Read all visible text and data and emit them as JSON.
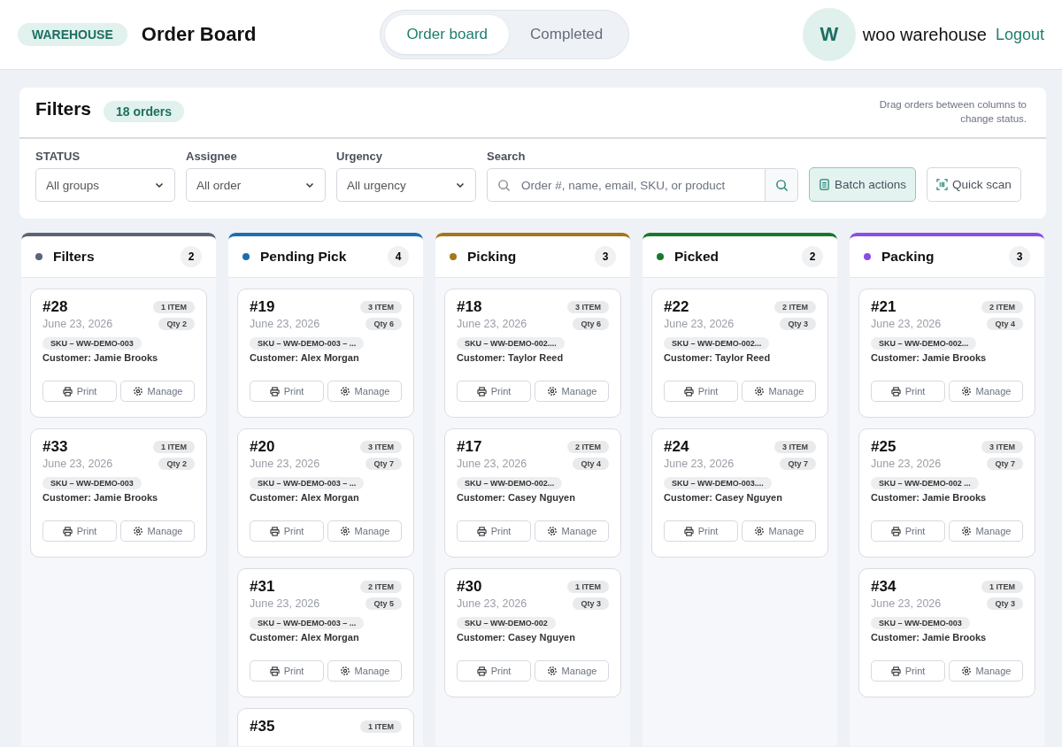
{
  "header": {
    "badge": "WAREHOUSE",
    "title": "Order Board",
    "tabs": [
      {
        "label": "Order board",
        "selected": true
      },
      {
        "label": "Completed",
        "selected": false
      }
    ],
    "avatar": "W",
    "user": "woo warehouse",
    "logout": "Logout"
  },
  "filters": {
    "title": "Filters",
    "count": "18 orders",
    "hint": "Drag orders between columns to change status.",
    "selects": [
      {
        "label": "STATUS",
        "value": "All groups"
      },
      {
        "label": "Assignee",
        "value": "All order"
      },
      {
        "label": "Urgency",
        "value": "All urgency"
      }
    ],
    "search": {
      "label": "Search",
      "placeholder": "Order #, name, email, SKU, or product"
    },
    "actions": [
      {
        "label": "Batch actions",
        "kind": "batch",
        "active": true
      },
      {
        "label": "Quick scan",
        "kind": "scan",
        "active": false
      }
    ]
  },
  "columns": [
    {
      "name": "Filters",
      "color": "#5b6478",
      "count": "2",
      "orders": [
        {
          "number": "#28",
          "items": "1 ITEM",
          "date": "June 23, 2026",
          "qty": "Qty 2",
          "sku": "SKU – WW-DEMO-003",
          "customer": "Customer: Jamie Brooks",
          "print": "Print",
          "manage": "Manage"
        },
        {
          "number": "#33",
          "items": "1 ITEM",
          "date": "June 23, 2026",
          "qty": "Qty 2",
          "sku": "SKU – WW-DEMO-003",
          "customer": "Customer: Jamie Brooks",
          "print": "Print",
          "manage": "Manage"
        }
      ]
    },
    {
      "name": "Pending Pick",
      "color": "#1a6fb3",
      "count": "4",
      "orders": [
        {
          "number": "#19",
          "items": "3 ITEM",
          "date": "June 23, 2026",
          "qty": "Qty 6",
          "sku": "SKU – WW-DEMO-003 – ...",
          "customer": "Customer: Alex Morgan",
          "print": "Print",
          "manage": "Manage"
        },
        {
          "number": "#20",
          "items": "3 ITEM",
          "date": "June 23, 2026",
          "qty": "Qty 7",
          "sku": "SKU – WW-DEMO-003 – ...",
          "customer": "Customer: Alex Morgan",
          "print": "Print",
          "manage": "Manage"
        },
        {
          "number": "#31",
          "items": "2 ITEM",
          "date": "June 23, 2026",
          "qty": "Qty 5",
          "sku": "SKU – WW-DEMO-003 – ...",
          "customer": "Customer: Alex Morgan",
          "print": "Print",
          "manage": "Manage"
        },
        {
          "number": "#35",
          "items": "1 ITEM"
        }
      ]
    },
    {
      "name": "Picking",
      "color": "#a6761a",
      "count": "3",
      "orders": [
        {
          "number": "#18",
          "items": "3 ITEM",
          "date": "June 23, 2026",
          "qty": "Qty 6",
          "sku": "SKU – WW-DEMO-002....",
          "customer": "Customer: Taylor Reed",
          "print": "Print",
          "manage": "Manage"
        },
        {
          "number": "#17",
          "items": "2 ITEM",
          "date": "June 23, 2026",
          "qty": "Qty 4",
          "sku": "SKU – WW-DEMO-002...",
          "customer": "Customer: Casey Nguyen",
          "print": "Print",
          "manage": "Manage"
        },
        {
          "number": "#30",
          "items": "1 ITEM",
          "date": "June 23, 2026",
          "qty": "Qty 3",
          "sku": "SKU – WW-DEMO-002",
          "customer": "Customer: Casey Nguyen",
          "print": "Print",
          "manage": "Manage"
        }
      ]
    },
    {
      "name": "Picked",
      "color": "#17782e",
      "count": "2",
      "orders": [
        {
          "number": "#22",
          "items": "2 ITEM",
          "date": "June 23, 2026",
          "qty": "Qty 3",
          "sku": "SKU – WW-DEMO-002...",
          "customer": "Customer: Taylor Reed",
          "print": "Print",
          "manage": "Manage"
        },
        {
          "number": "#24",
          "items": "3 ITEM",
          "date": "June 23, 2026",
          "qty": "Qty 7",
          "sku": "SKU – WW-DEMO-003....",
          "customer": "Customer: Casey Nguyen",
          "print": "Print",
          "manage": "Manage"
        }
      ]
    },
    {
      "name": "Packing",
      "color": "#8a4de8",
      "count": "3",
      "orders": [
        {
          "number": "#21",
          "items": "2 ITEM",
          "date": "June 23, 2026",
          "qty": "Qty 4",
          "sku": "SKU – WW-DEMO-002...",
          "customer": "Customer: Jamie Brooks",
          "print": "Print",
          "manage": "Manage"
        },
        {
          "number": "#25",
          "items": "3 ITEM",
          "date": "June 23, 2026",
          "qty": "Qty 7",
          "sku": "SKU – WW-DEMO-002 ...",
          "customer": "Customer: Jamie Brooks",
          "print": "Print",
          "manage": "Manage"
        },
        {
          "number": "#34",
          "items": "1 ITEM",
          "date": "June 23, 2026",
          "qty": "Qty 3",
          "sku": "SKU – WW-DEMO-003",
          "customer": "Customer: Jamie Brooks",
          "print": "Print",
          "manage": "Manage"
        }
      ]
    }
  ]
}
